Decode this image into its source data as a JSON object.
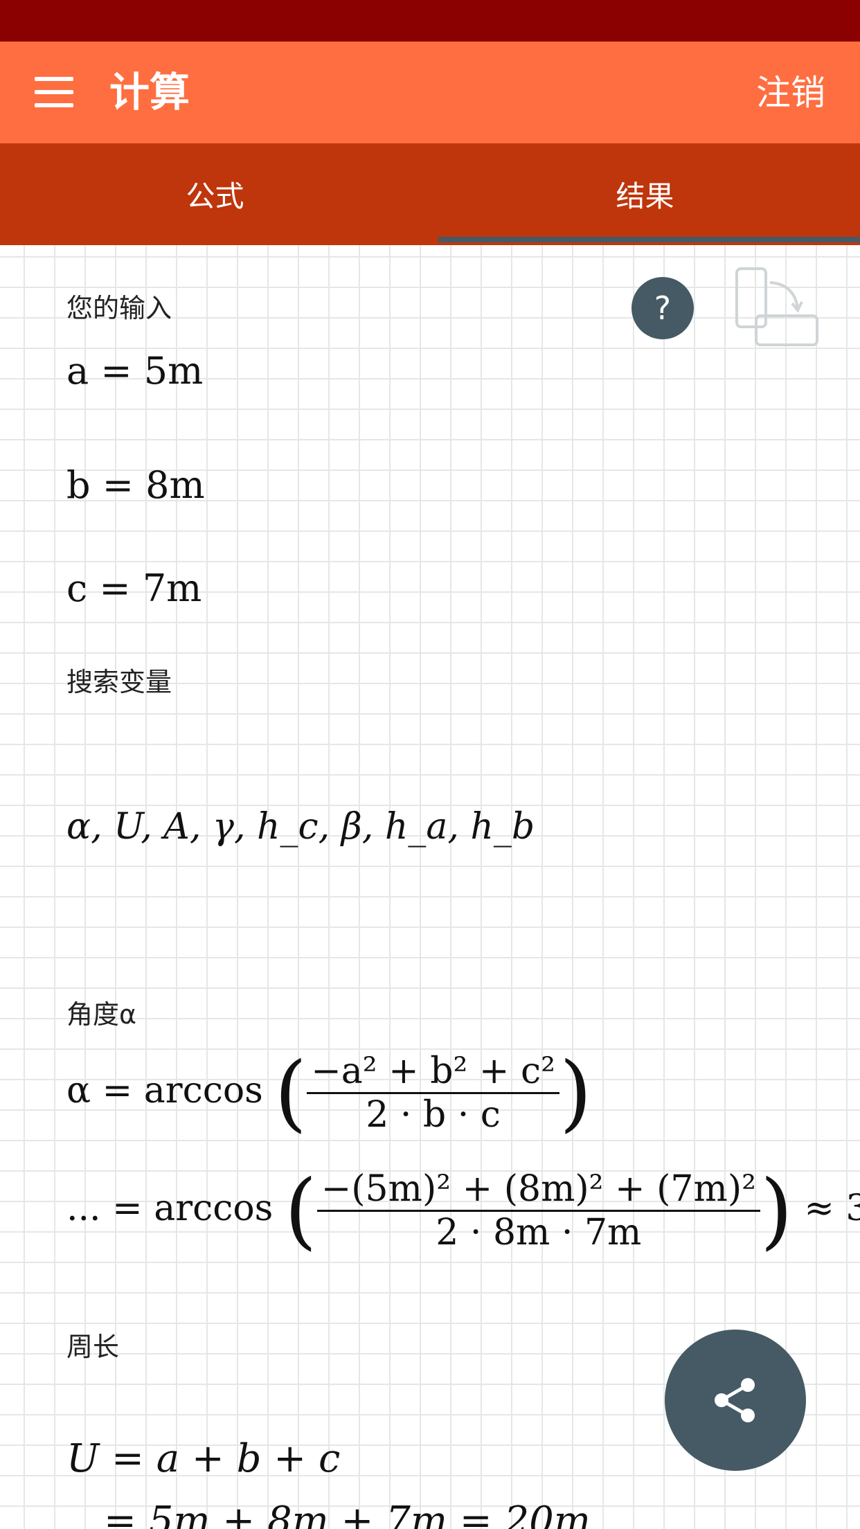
{
  "header": {
    "title": "计算",
    "logout_label": "注销"
  },
  "tabs": [
    {
      "label": "公式"
    },
    {
      "label": "结果"
    }
  ],
  "sections": {
    "input_label": "您的输入",
    "search_label": "搜索变量",
    "angle_label": "角度α",
    "perimeter_label": "周长"
  },
  "inputs": [
    "a = 5m",
    "b = 8m",
    "c = 7m"
  ],
  "search_vars": "α, U, A, γ, h_c, β, h_a, h_b",
  "formulas": {
    "alpha_prefix": "α = arccos",
    "alpha_num": "−a² + b² + c²",
    "alpha_den": "2 · b · c",
    "alpha_sub_prefix": "... = arccos",
    "alpha_sub_num": "−(5m)² + (8m)² + (7m)²",
    "alpha_sub_den": "2 · 8m · 7m",
    "alpha_approx": "≈ 3",
    "perimeter_eq": "U = a + b + c",
    "perimeter_sub": "= 5m + 8m + 7m = 20m"
  },
  "icons": {
    "menu": "menu-icon",
    "help": "help-icon",
    "rotate": "rotate-screen-icon",
    "share": "share-icon"
  },
  "help_label": "?",
  "colors": {
    "status_bar": "#8b0000",
    "app_bar": "#ff6e40",
    "tab_bar": "#bf360c",
    "accent": "#455a64"
  }
}
